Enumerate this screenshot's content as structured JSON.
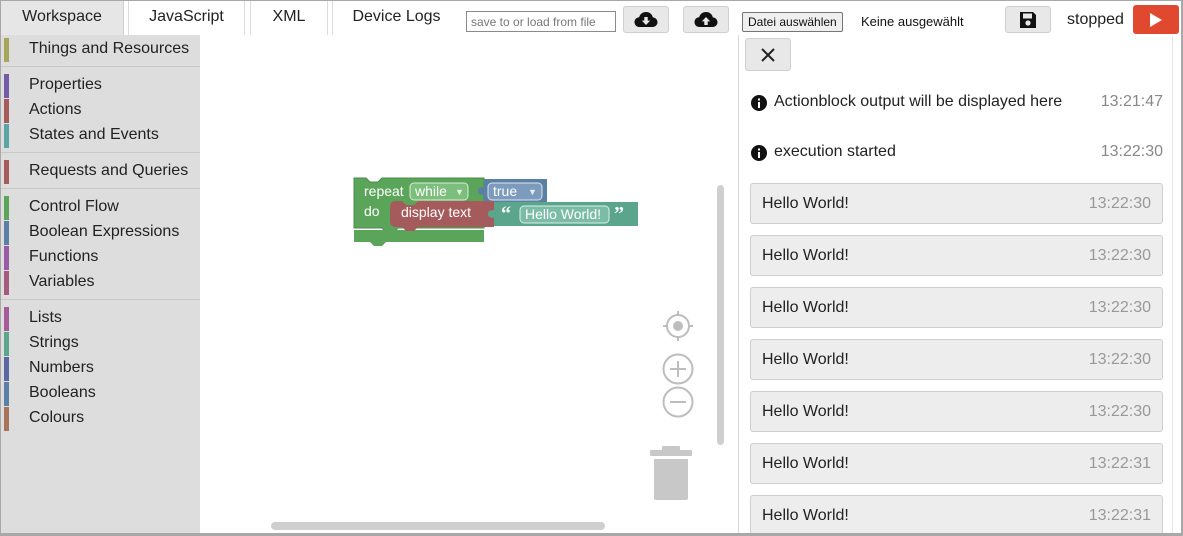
{
  "tabs": {
    "workspace": "Workspace",
    "javascript": "JavaScript",
    "xml": "XML",
    "device_logs": "Device Logs"
  },
  "file": {
    "placeholder": "save to or load from file",
    "choose_label": "Datei auswählen",
    "none_selected": "Keine ausgewählt"
  },
  "toolbar_icons": {
    "download": "cloud-download-icon",
    "upload": "cloud-upload-icon",
    "save": "floppy-disk-icon",
    "run": "play-icon"
  },
  "run_status": "stopped",
  "toolbox": {
    "categories": [
      {
        "label": "Things and Resources",
        "color": "#a5a55b"
      },
      {
        "label": "Properties",
        "color": "#745ba5"
      },
      {
        "label": "Actions",
        "color": "#a55b5b"
      },
      {
        "label": "States and Events",
        "color": "#5ba5a5"
      },
      {
        "label": "Requests and Queries",
        "color": "#a55b5b"
      },
      {
        "label": "Control Flow",
        "color": "#5ba55b"
      },
      {
        "label": "Boolean Expressions",
        "color": "#5b80a5"
      },
      {
        "label": "Functions",
        "color": "#995ba5"
      },
      {
        "label": "Variables",
        "color": "#a55b80"
      },
      {
        "label": "Lists",
        "color": "#a55b99"
      },
      {
        "label": "Strings",
        "color": "#5ba58c"
      },
      {
        "label": "Numbers",
        "color": "#5b67a5"
      },
      {
        "label": "Booleans",
        "color": "#5b80a5"
      },
      {
        "label": "Colours",
        "color": "#a5745b"
      }
    ]
  },
  "blocks": {
    "repeat_label": "repeat",
    "mode": "while",
    "condition": "true",
    "do_label": "do",
    "action": "display text",
    "text_value": "Hello World!",
    "colors": {
      "loop": "#5ba55b",
      "boolean": "#5b80a5",
      "action": "#a55b5b",
      "string": "#5ba58c"
    }
  },
  "workspace_controls": [
    "recenter-icon",
    "zoom-in-icon",
    "zoom-out-icon",
    "trash-icon"
  ],
  "output": {
    "close_icon": "close-icon",
    "info_messages": [
      {
        "text": "Actionblock output will be displayed here",
        "time": "13:21:47"
      },
      {
        "text": "execution started",
        "time": "13:22:30"
      }
    ],
    "entries": [
      {
        "text": "Hello World!",
        "time": "13:22:30"
      },
      {
        "text": "Hello World!",
        "time": "13:22:30"
      },
      {
        "text": "Hello World!",
        "time": "13:22:30"
      },
      {
        "text": "Hello World!",
        "time": "13:22:30"
      },
      {
        "text": "Hello World!",
        "time": "13:22:30"
      },
      {
        "text": "Hello World!",
        "time": "13:22:31"
      },
      {
        "text": "Hello World!",
        "time": "13:22:31"
      }
    ]
  }
}
